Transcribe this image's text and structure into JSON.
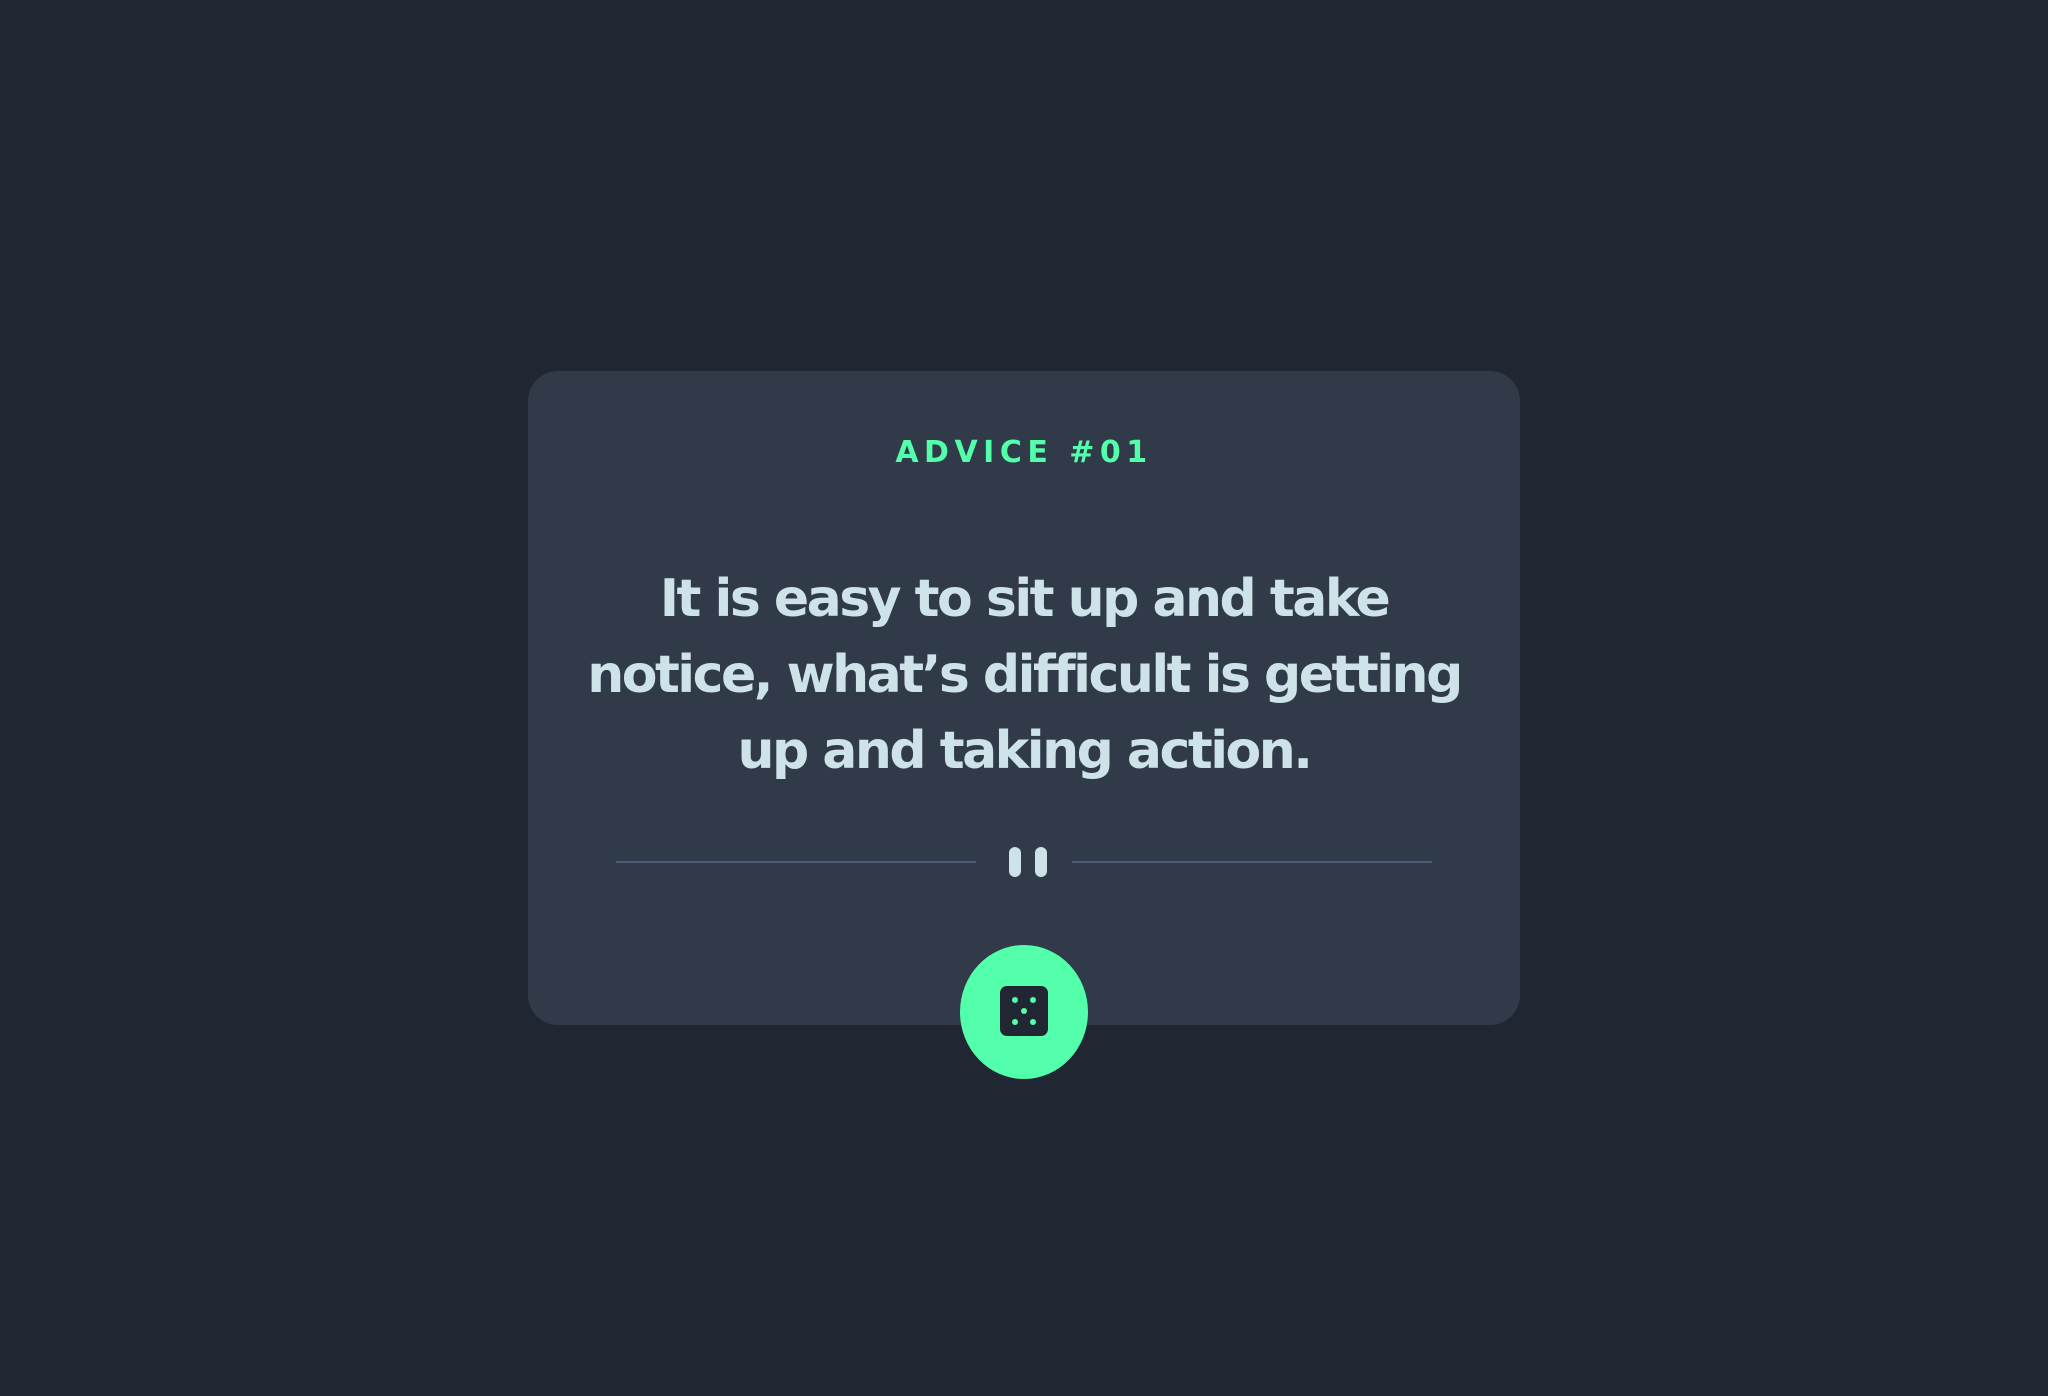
{
  "advice": {
    "heading": "ADVICE #01",
    "quote": "It is easy to sit up and take notice, what’s difficult is getting up and taking action."
  },
  "divider": {
    "icon": "pause-icon"
  },
  "button": {
    "icon": "dice-icon",
    "aria_label": "Get new advice"
  },
  "colors": {
    "background": "#202632",
    "card": "#313A49",
    "accent": "#53FFAA",
    "text": "#CEE3E9",
    "divider": "#4F5D74"
  }
}
